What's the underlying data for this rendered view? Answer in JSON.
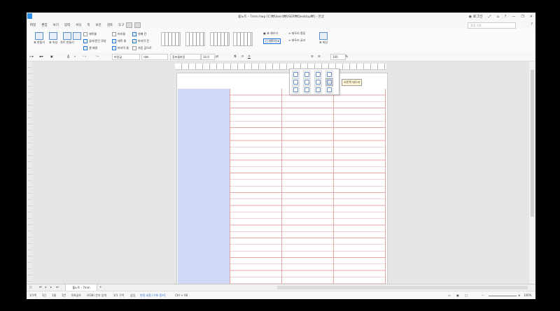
{
  "window": {
    "title": "홀노트 - 7mm.hwp [C:₩Users₩USER₩Desktop₩] - 한글",
    "login_label": "로그인"
  },
  "menu": {
    "items": [
      "파일",
      "편집",
      "보기",
      "입력",
      "서식",
      "쪽",
      "보안",
      "검토",
      "도구"
    ],
    "search_placeholder": "찾을 내용",
    "help": "?"
  },
  "ribbon": {
    "table_create": "표 만들기",
    "table_props": "표 속성",
    "table_create2": "차트 만들기",
    "checks": [
      {
        "label": "제목줄",
        "on": false
      },
      {
        "label": "글자/문단 모양",
        "on": true
      },
      {
        "label": "셀 배경",
        "on": true
      },
      {
        "label": "머리줄",
        "on": false
      },
      {
        "label": "제목 줄",
        "on": true
      },
      {
        "label": "마지막 줄",
        "on": true
      },
      {
        "label": "첫째 칸",
        "on": true
      },
      {
        "label": "마지막 칸",
        "on": true
      },
      {
        "label": "처음 값으로",
        "on": false
      }
    ],
    "border_label": "표 채우기",
    "border_type_label": "테두리 종류",
    "border_thickness_label": "테두리 굵기",
    "border_button": "테두리",
    "eraser_label": "셀 지우개",
    "extra_label": "표 마당"
  },
  "format": {
    "style": "바탕글",
    "lang": "대표",
    "font": "함초롬바탕",
    "size": "10.0",
    "unit": "pt",
    "zoom": "100",
    "percent": "%"
  },
  "dropdown": {
    "tooltip": "오른쪽 테두리"
  },
  "document_tab": "홀노트 - 7mm",
  "status": {
    "page": "1/1쪽",
    "section": "1단",
    "line": "1줄",
    "col": "1칸",
    "chars": "0/0글자",
    "mode": "(A38) 문자 입력",
    "section2": "1/1 구역",
    "insert": "삽입",
    "change": "변경 내용 [기록 중지]",
    "shortcut": "Ctrl + 08",
    "zoom": "100%"
  }
}
